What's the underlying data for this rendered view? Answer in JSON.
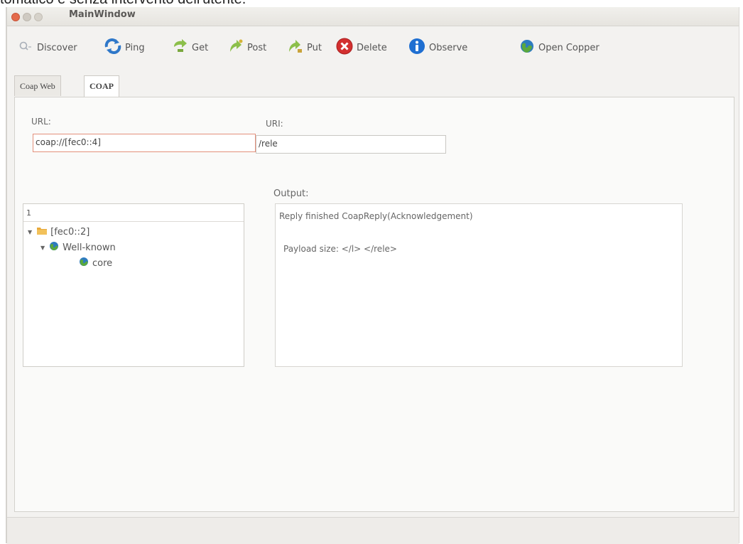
{
  "page_caption": "tomatico e senza intervento dell'utente.",
  "window": {
    "title": "MainWindow"
  },
  "toolbar": {
    "items": [
      {
        "label": "Discover",
        "icon": "discover-icon",
        "color": "#9aa3b0"
      },
      {
        "label": "Ping",
        "icon": "ping-icon",
        "color": "#2f78c9"
      },
      {
        "label": "Get",
        "icon": "get-icon",
        "color": "#8cbf4a"
      },
      {
        "label": "Post",
        "icon": "post-icon",
        "color": "#8cbf4a"
      },
      {
        "label": "Put",
        "icon": "put-icon",
        "color": "#8cbf4a"
      },
      {
        "label": "Delete",
        "icon": "delete-icon",
        "color": "#d32f2f"
      },
      {
        "label": "Observe",
        "icon": "info-icon",
        "color": "#1f6fd1"
      },
      {
        "label": "Open Copper",
        "icon": "globe-icon",
        "color": "#2e7bbf"
      }
    ]
  },
  "tabs": [
    {
      "label": "Coap Web",
      "active": false
    },
    {
      "label": "COAP",
      "active": true
    }
  ],
  "form": {
    "url_label": "URL:",
    "url_value": "coap://[fec0::4]",
    "uri_label": "URI:",
    "uri_value": "/rele"
  },
  "tree": {
    "header": "1",
    "nodes": [
      {
        "label": "[fec0::2]",
        "icon": "folder-icon",
        "expanded": true
      },
      {
        "label": "Well-known",
        "icon": "globe-icon",
        "expanded": true
      },
      {
        "label": "core",
        "icon": "globe-icon"
      }
    ]
  },
  "output": {
    "label": "Output:",
    "line1": "Reply finished CoapReply(Acknowledgement)",
    "line2": "Payload size: </l> </rele>"
  }
}
